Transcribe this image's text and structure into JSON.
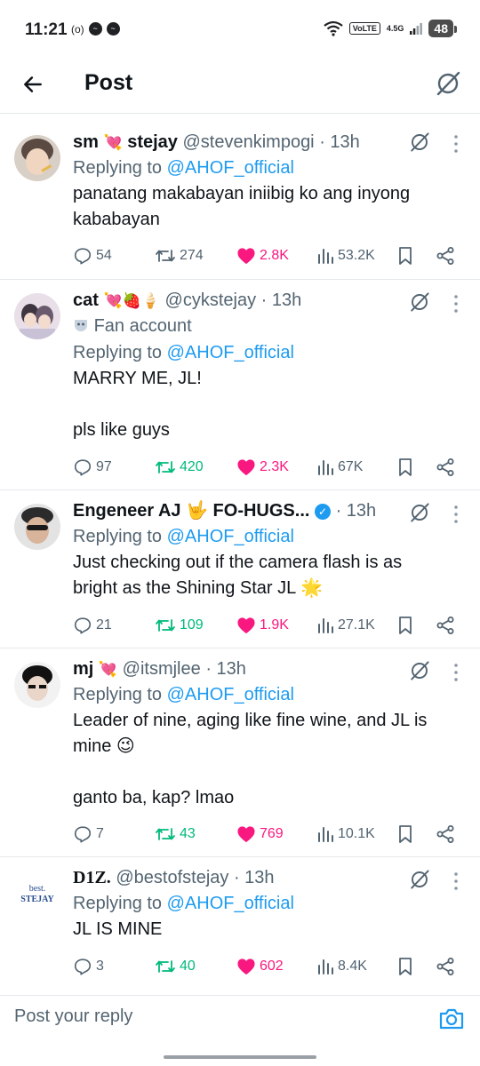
{
  "status_bar": {
    "time": "11:21",
    "left_icons": [
      "nfc-icon",
      "messenger-icon",
      "messenger-icon"
    ],
    "volte": "VoLTE",
    "network": "4.5G",
    "battery": "48"
  },
  "header": {
    "title": "Post",
    "back_icon": "arrow-left-icon",
    "grok_icon": "grok-icon"
  },
  "colors": {
    "accent": "#1d9bf0",
    "like": "#f91880",
    "retweet": "#00ba7c",
    "secondary_text": "#536471"
  },
  "replies": [
    {
      "name": "sm",
      "name_emoji": "💘",
      "name_suffix": "stejay",
      "handle": "@stevenkimpogi",
      "time": "· 13h",
      "replying_label": "Replying to",
      "replying_to": "@AHOF_official",
      "text": [
        "panatang makabayan iniibig ko ang inyong",
        "kababayan"
      ],
      "replies": "54",
      "retweets": "274",
      "likes": "2.8K",
      "views": "53.2K"
    },
    {
      "name": "cat",
      "name_emoji": "💘🍓🍦",
      "handle": "@cykstejay",
      "time": "· 13h",
      "fan_label": "Fan account",
      "replying_label": "Replying to",
      "replying_to": "@AHOF_official",
      "text": [
        "MARRY ME, JL!",
        "",
        "pls like guys"
      ],
      "replies": "97",
      "retweets": "420",
      "likes": "2.3K",
      "views": "67K"
    },
    {
      "name": "Engeneer AJ 🤟 FO-HUGS...",
      "handle": "",
      "time": "· 13h",
      "replying_label": "Replying to",
      "replying_to": "@AHOF_official",
      "text": [
        "Just checking out if the camera flash is as",
        "bright as the Shining Star  JL 🌟"
      ],
      "replies": "21",
      "retweets": "109",
      "likes": "1.9K",
      "views": "27.1K"
    },
    {
      "name": "mj",
      "name_emoji": "💘",
      "handle": "@itsmjlee",
      "time": "· 13h",
      "replying_label": "Replying to",
      "replying_to": "@AHOF_official",
      "text": [
        "Leader of nine, aging like fine wine, and JL is",
        "mine 😉",
        "",
        "ganto ba, kap? lmao"
      ],
      "replies": "7",
      "retweets": "43",
      "likes": "769",
      "views": "10.1K"
    },
    {
      "name": "D1Z.",
      "handle": "@bestofstejay",
      "time": "· 13h",
      "avatar_text": "best.\nSTEJAY",
      "replying_label": "Replying to",
      "replying_to": "@AHOF_official",
      "text": [
        "JL IS MINE"
      ],
      "replies": "3",
      "retweets": "40",
      "likes": "602",
      "views": "8.4K"
    }
  ],
  "reply_bar": {
    "placeholder": "Post your reply",
    "camera_icon": "camera-icon"
  }
}
